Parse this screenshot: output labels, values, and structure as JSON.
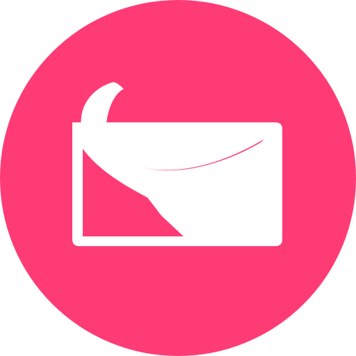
{
  "icon": {
    "name": "mail-envelope-icon",
    "background_color": "#ff3b76",
    "foreground_color": "#ffffff"
  }
}
